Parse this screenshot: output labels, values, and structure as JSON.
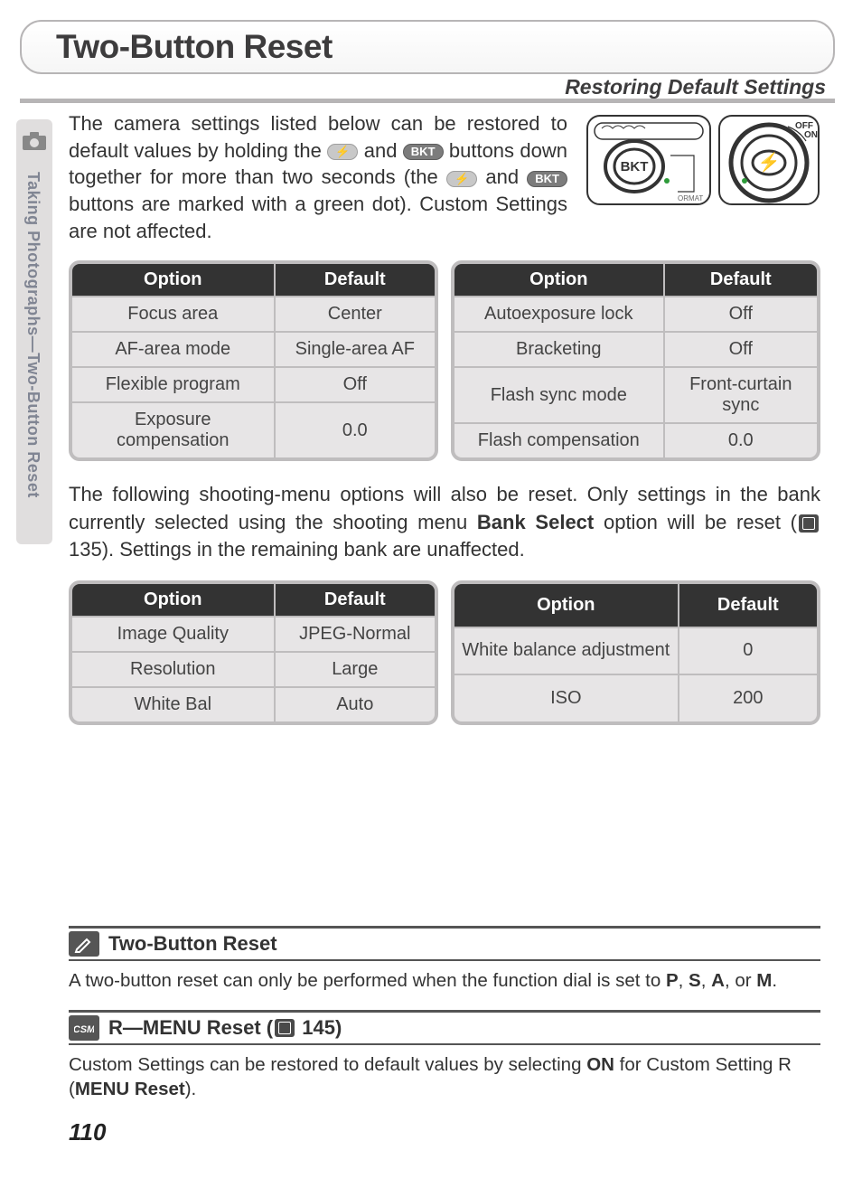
{
  "title": "Two-Button Reset",
  "subtitle": "Restoring Default Settings",
  "sidebar_label": "Taking Photographs—Two-Button Reset",
  "intro": {
    "p1a": "The camera settings listed below can be restored to default values by holding the ",
    "p1b": " and ",
    "p1c": " buttons down together for more than two seconds (the ",
    "p1d": " and ",
    "p1e": " buttons are marked with a green dot).  Custom Settings are not affected.",
    "flash_glyph": "⚡",
    "bkt_glyph": "BKT"
  },
  "tables1": {
    "left": {
      "headers": [
        "Option",
        "Default"
      ],
      "rows": [
        [
          "Focus area",
          "Center"
        ],
        [
          "AF-area mode",
          "Single-area AF"
        ],
        [
          "Flexible program",
          "Off"
        ],
        [
          "Exposure compensation",
          "0.0"
        ]
      ]
    },
    "right": {
      "headers": [
        "Option",
        "Default"
      ],
      "rows": [
        [
          "Autoexposure lock",
          "Off"
        ],
        [
          "Bracketing",
          "Off"
        ],
        [
          "Flash sync mode",
          "Front-curtain sync"
        ],
        [
          "Flash compensation",
          "0.0"
        ]
      ]
    }
  },
  "para2": {
    "a": "The following shooting-menu options will also be reset.  Only settings in the bank currently selected using the shooting menu ",
    "bold": "Bank Select",
    "b": " option will be reset (",
    "ref": " 135).  Settings in the remaining bank are unaffected."
  },
  "tables2": {
    "left": {
      "headers": [
        "Option",
        "Default"
      ],
      "rows": [
        [
          "Image Quality",
          "JPEG-Normal"
        ],
        [
          "Resolution",
          "Large"
        ],
        [
          "White Bal",
          "Auto"
        ]
      ]
    },
    "right": {
      "headers": [
        "Option",
        "Default"
      ],
      "rows": [
        [
          "White balance adjustment",
          "0"
        ],
        [
          "ISO",
          "200"
        ]
      ]
    }
  },
  "note1": {
    "title": "Two-Button Reset",
    "body_a": "A two-button reset can only be performed when the function dial is set to ",
    "modes": [
      "P",
      "S",
      "A",
      "M"
    ],
    "body_b": "."
  },
  "note2": {
    "title_a": "R—MENU Reset (",
    "title_ref": " 145)",
    "body_a": "Custom Settings can be restored to default values by selecting ",
    "on": "ON",
    "body_b": " for Custom Setting R (",
    "bold": "MENU Reset",
    "body_c": ")."
  },
  "page_number": "110"
}
